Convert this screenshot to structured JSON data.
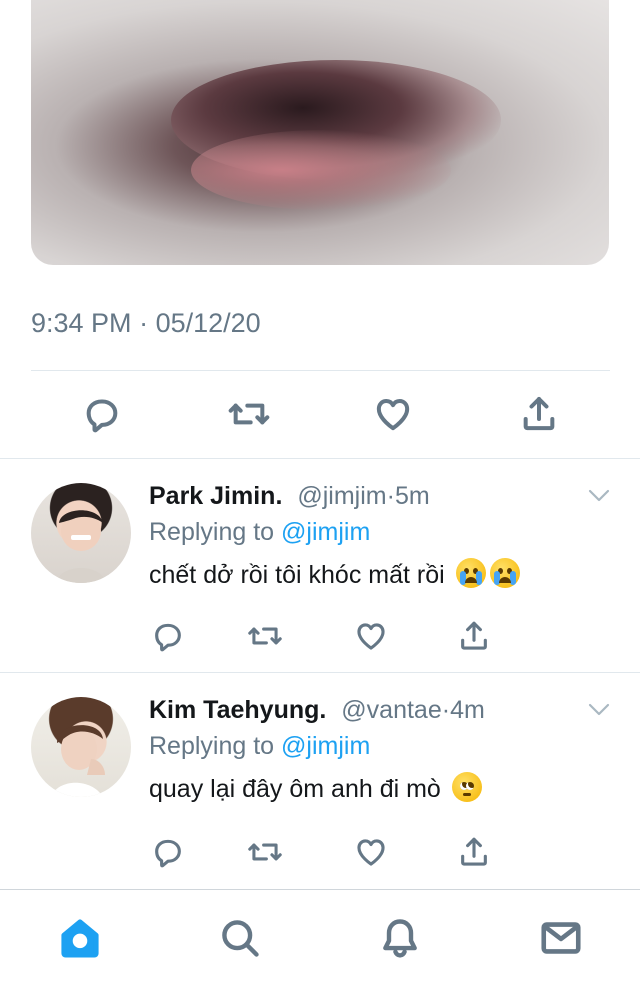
{
  "tweet": {
    "time": "9:34 PM",
    "separator": "·",
    "date": "05/12/20"
  },
  "replies": [
    {
      "name": "Park Jimin.",
      "handle": "@jimjim",
      "separator": "·",
      "age": "5m",
      "replying_prefix": "Replying to",
      "replying_to": "@jimjim",
      "text": "chết dở rồi tôi khóc mất rồi",
      "emoji": [
        "loudly-crying-face",
        "loudly-crying-face"
      ]
    },
    {
      "name": "Kim Taehyung.",
      "handle": "@vantae",
      "separator": "·",
      "age": "4m",
      "replying_prefix": "Replying to",
      "replying_to": "@jimjim",
      "text": "quay lại đây ôm anh đi mò",
      "emoji": [
        "pleading-face"
      ]
    }
  ],
  "colors": {
    "accent": "#1da1f2",
    "muted": "#657786",
    "divider": "#e1e8ed"
  },
  "icons": {
    "actions": [
      "reply-icon",
      "retweet-icon",
      "like-icon",
      "share-icon"
    ],
    "tabs": [
      "home-icon",
      "search-icon",
      "notifications-icon",
      "messages-icon"
    ]
  }
}
